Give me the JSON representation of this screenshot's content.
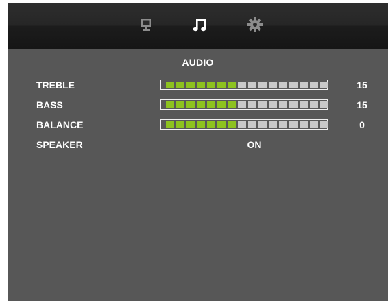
{
  "tabs": [
    {
      "icon": "monitor-icon",
      "active": false
    },
    {
      "icon": "music-note-icon",
      "active": true
    },
    {
      "icon": "gear-icon",
      "active": false
    }
  ],
  "panel": {
    "title": "AUDIO"
  },
  "settings": {
    "treble": {
      "label": "TREBLE",
      "value": "15",
      "level": 0.5
    },
    "bass": {
      "label": "BASS",
      "value": "15",
      "level": 0.5
    },
    "balance": {
      "label": "BALANCE",
      "value": "0",
      "level": 0.5
    },
    "speaker": {
      "label": "SPEAKER",
      "value": "ON"
    }
  },
  "colors": {
    "panel_bg": "#575757",
    "tabbar_bg": "#1c1c1c",
    "segment_on": "#8dc21f",
    "segment_off": "#c8c8c8",
    "icon_dim": "#8c8c8c",
    "icon_active": "#ffffff",
    "text": "#ffffff"
  }
}
